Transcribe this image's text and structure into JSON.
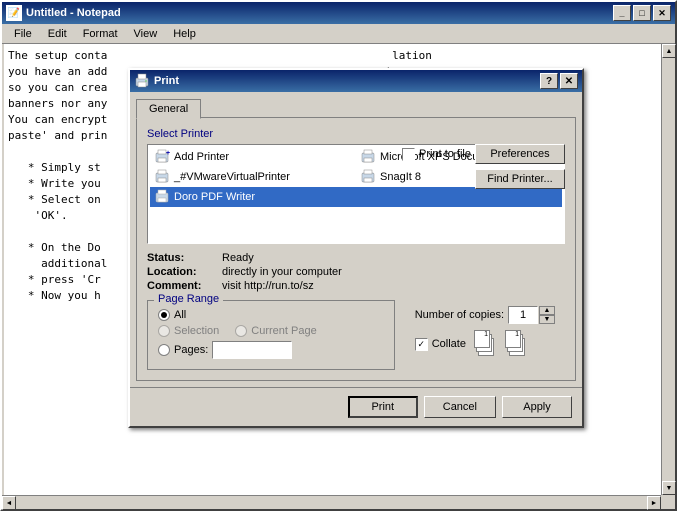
{
  "notepad": {
    "title": "Untitled - Notepad",
    "menu": [
      "File",
      "Edit",
      "Format",
      "View",
      "Help"
    ],
    "content_lines": [
      "The setup conta",
      "you have an add",
      "so you can crea",
      "banners nor any",
      "You can encrypt",
      "paste' and prin",
      "",
      "   * Simply st",
      "   * Write you",
      "   * Select on",
      "     'OK'.",
      "",
      "   * On the Do",
      "     additional",
      "   * press 'Cr",
      "   * Now you h"
    ]
  },
  "dialog": {
    "title": "Print",
    "tabs": [
      "General"
    ],
    "active_tab": "General",
    "select_printer_label": "Select Printer",
    "printers": [
      {
        "name": "Add Printer",
        "type": "add"
      },
      {
        "name": "Microsoft XPS Document Writer",
        "type": "xps"
      },
      {
        "name": "_#VMwareVirtualPrinter",
        "type": "vmware"
      },
      {
        "name": "SnagIt 8",
        "type": "snagit"
      },
      {
        "name": "Doro PDF Writer",
        "type": "doro",
        "selected": true
      }
    ],
    "status_label": "Status:",
    "status_value": "Ready",
    "location_label": "Location:",
    "location_value": "directly in your computer",
    "comment_label": "Comment:",
    "comment_value": "visit http://run.to/sz",
    "print_to_file_label": "Print to file",
    "print_to_file_checked": false,
    "preferences_label": "Preferences",
    "find_printer_label": "Find Printer...",
    "page_range_legend": "Page Range",
    "page_range_options": [
      {
        "label": "All",
        "value": "all",
        "checked": true
      },
      {
        "label": "Selection",
        "value": "selection",
        "checked": false,
        "disabled": true
      },
      {
        "label": "Current Page",
        "value": "current",
        "checked": false,
        "disabled": true
      },
      {
        "label": "Pages:",
        "value": "pages",
        "checked": false
      }
    ],
    "pages_input_value": "",
    "copies_label": "Number of copies:",
    "copies_value": "1",
    "collate_label": "Collate",
    "collate_checked": true,
    "buttons": {
      "print": "Print",
      "cancel": "Cancel",
      "apply": "Apply"
    },
    "help_button": "?",
    "close_button": "✕"
  },
  "titlebar_buttons": {
    "minimize": "_",
    "maximize": "□",
    "close": "✕"
  }
}
